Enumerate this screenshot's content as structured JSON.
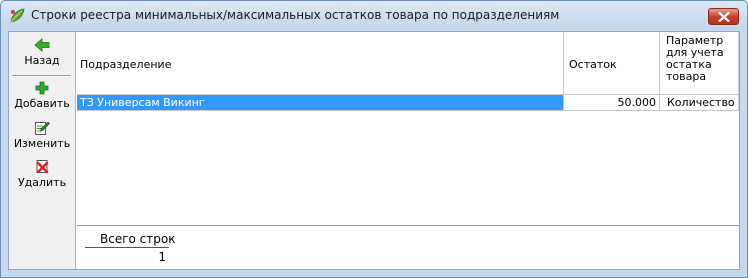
{
  "window": {
    "title": "Строки реестра минимальных/максимальных остатков товара по подразделениям"
  },
  "toolbar": {
    "back_label": "Назад",
    "add_label": "Добавить",
    "edit_label": "Изменить",
    "delete_label": "Удалить"
  },
  "grid": {
    "columns": [
      {
        "label": "Подразделение"
      },
      {
        "label": "Остаток"
      },
      {
        "label": "Параметр для учета остатка товара"
      }
    ],
    "rows": [
      {
        "division": "ТЗ Универсам Викинг",
        "balance": "50.000",
        "parameter": "Количество",
        "selected": true
      }
    ]
  },
  "footer": {
    "total_label": "Всего строк",
    "total_value": "1"
  },
  "colors": {
    "selection": "#3399ff",
    "titlebar": "#c7d9ee",
    "toolbar_bg": "#f0f0f0"
  },
  "icons": {
    "app": "app-leaf-icon",
    "close": "close-icon",
    "back": "arrow-left-icon",
    "add": "plus-icon",
    "edit": "edit-document-icon",
    "delete": "delete-document-icon"
  }
}
